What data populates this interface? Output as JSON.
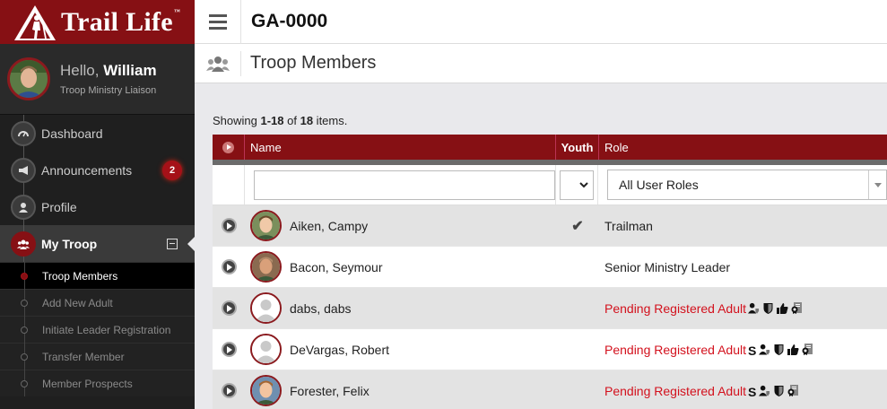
{
  "brand": {
    "name": "Trail Life",
    "tm": "™"
  },
  "user": {
    "greeting": "Hello,",
    "name": "William",
    "role": "Troop Ministry Liaison"
  },
  "nav": {
    "items": [
      {
        "label": "Dashboard",
        "icon": "dashboard-icon"
      },
      {
        "label": "Announcements",
        "icon": "megaphone-icon",
        "badge": "2"
      },
      {
        "label": "Profile",
        "icon": "user-icon"
      },
      {
        "label": "My Troop",
        "icon": "group-icon",
        "active": true
      }
    ],
    "subitems": [
      {
        "label": "Troop Members",
        "active": true
      },
      {
        "label": "Add New Adult"
      },
      {
        "label": "Initiate Leader Registration"
      },
      {
        "label": "Transfer Member"
      },
      {
        "label": "Member Prospects"
      }
    ]
  },
  "header": {
    "troop_id": "GA-0000"
  },
  "page": {
    "title": "Troop Members"
  },
  "summary": {
    "prefix": "Showing ",
    "range": "1-18",
    "mid": " of ",
    "total": "18",
    "suffix": " items."
  },
  "grid": {
    "columns": {
      "name": "Name",
      "youth": "Youth",
      "role": "Role"
    },
    "filters": {
      "name_value": "",
      "youth_value": "",
      "role_value": "All User Roles"
    },
    "rows": [
      {
        "name": "Aiken, Campy",
        "youth": true,
        "role": "Trailman",
        "pending": false,
        "avatar": "photo",
        "icons": []
      },
      {
        "name": "Bacon, Seymour",
        "youth": false,
        "role": "Senior Ministry Leader",
        "pending": false,
        "avatar": "photo",
        "icons": []
      },
      {
        "name": "dabs, dabs",
        "youth": false,
        "role": "Pending Registered Adult",
        "pending": true,
        "avatar": "placeholder",
        "icons": [
          "user-shield-icon",
          "shield-icon",
          "thumbs-up-icon",
          "badge-doc-icon"
        ]
      },
      {
        "name": "DeVargas, Robert",
        "youth": false,
        "role": "Pending Registered Adult",
        "pending": true,
        "avatar": "placeholder",
        "icons": [
          "dollar-icon",
          "user-shield-icon",
          "shield-icon",
          "thumbs-up-icon",
          "badge-doc-icon"
        ]
      },
      {
        "name": "Forester, Felix",
        "youth": false,
        "role": "Pending Registered Adult",
        "pending": true,
        "avatar": "photo",
        "icons": [
          "dollar-icon",
          "user-shield-icon",
          "shield-icon",
          "badge-doc-icon"
        ]
      }
    ],
    "dollar_glyph": "S",
    "check_glyph": "✔"
  },
  "colors": {
    "brand_red": "#861014",
    "pending_red": "#d3111d",
    "sidebar_bg": "#1f1f1f"
  }
}
